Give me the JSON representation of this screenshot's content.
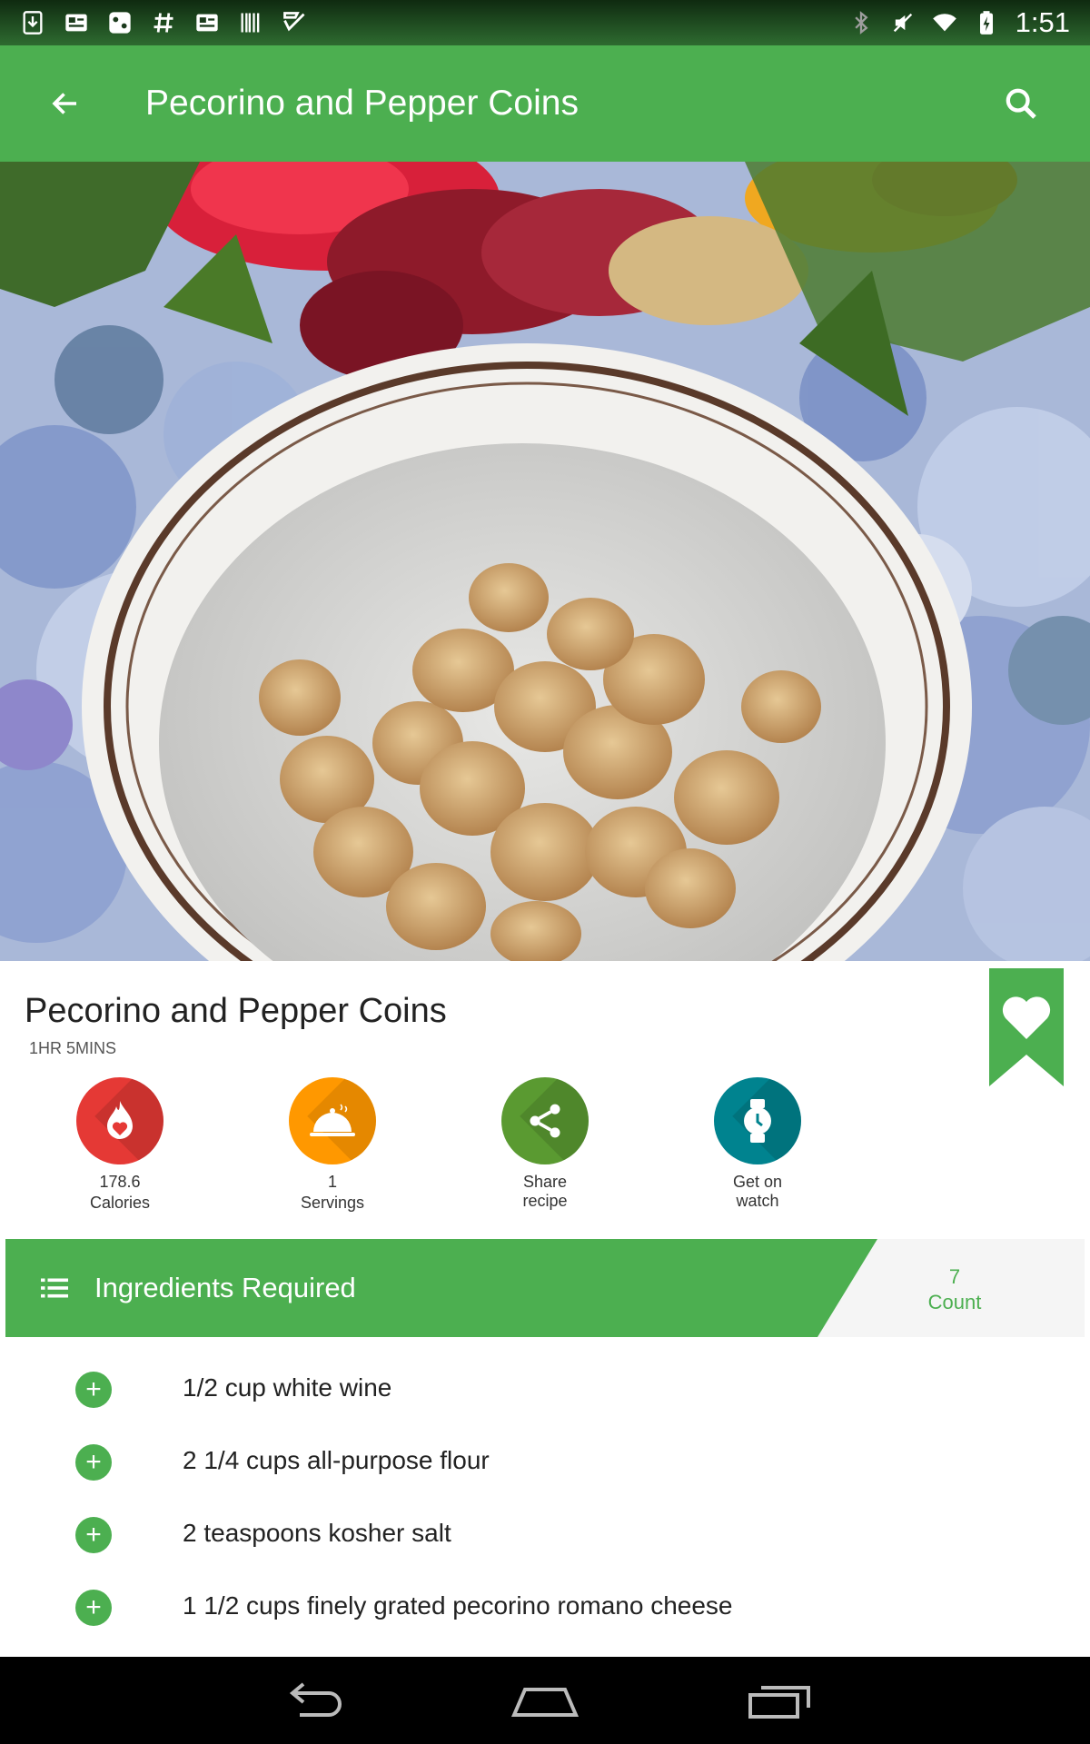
{
  "status_bar": {
    "time": "1:51",
    "left_icons": [
      "download-icon",
      "news-icon",
      "game-icon",
      "hashtag-icon",
      "news-icon",
      "barcode-icon",
      "task-icon"
    ],
    "right_icons": [
      "bluetooth-icon",
      "mute-icon",
      "wifi-icon",
      "battery-icon"
    ]
  },
  "app_bar": {
    "title": "Pecorino and Pepper Coins",
    "back_icon": "arrow-back-icon",
    "search_icon": "search-icon",
    "color": "#4caf50"
  },
  "recipe": {
    "title": "Pecorino and Pepper Coins",
    "time": "1HR 5MINS",
    "stats": [
      {
        "value": "178.6",
        "label": "Calories",
        "icon": "flame-heart-icon",
        "color": "#e53935"
      },
      {
        "value": "1",
        "label": "Servings",
        "icon": "cloche-icon",
        "color": "#ff9800"
      },
      {
        "value": "Share",
        "label": "recipe",
        "icon": "share-icon",
        "color": "#5a9a31"
      },
      {
        "value": "Get on",
        "label": "watch",
        "icon": "watch-icon",
        "color": "#00838f"
      }
    ]
  },
  "ingredients": {
    "header": "Ingredients Required",
    "count_value": "7",
    "count_label": "Count",
    "items": [
      "1/2 cup white wine",
      "2 1/4 cups all-purpose flour",
      "2 teaspoons kosher salt",
      "1 1/2 cups finely grated pecorino romano cheese"
    ]
  }
}
